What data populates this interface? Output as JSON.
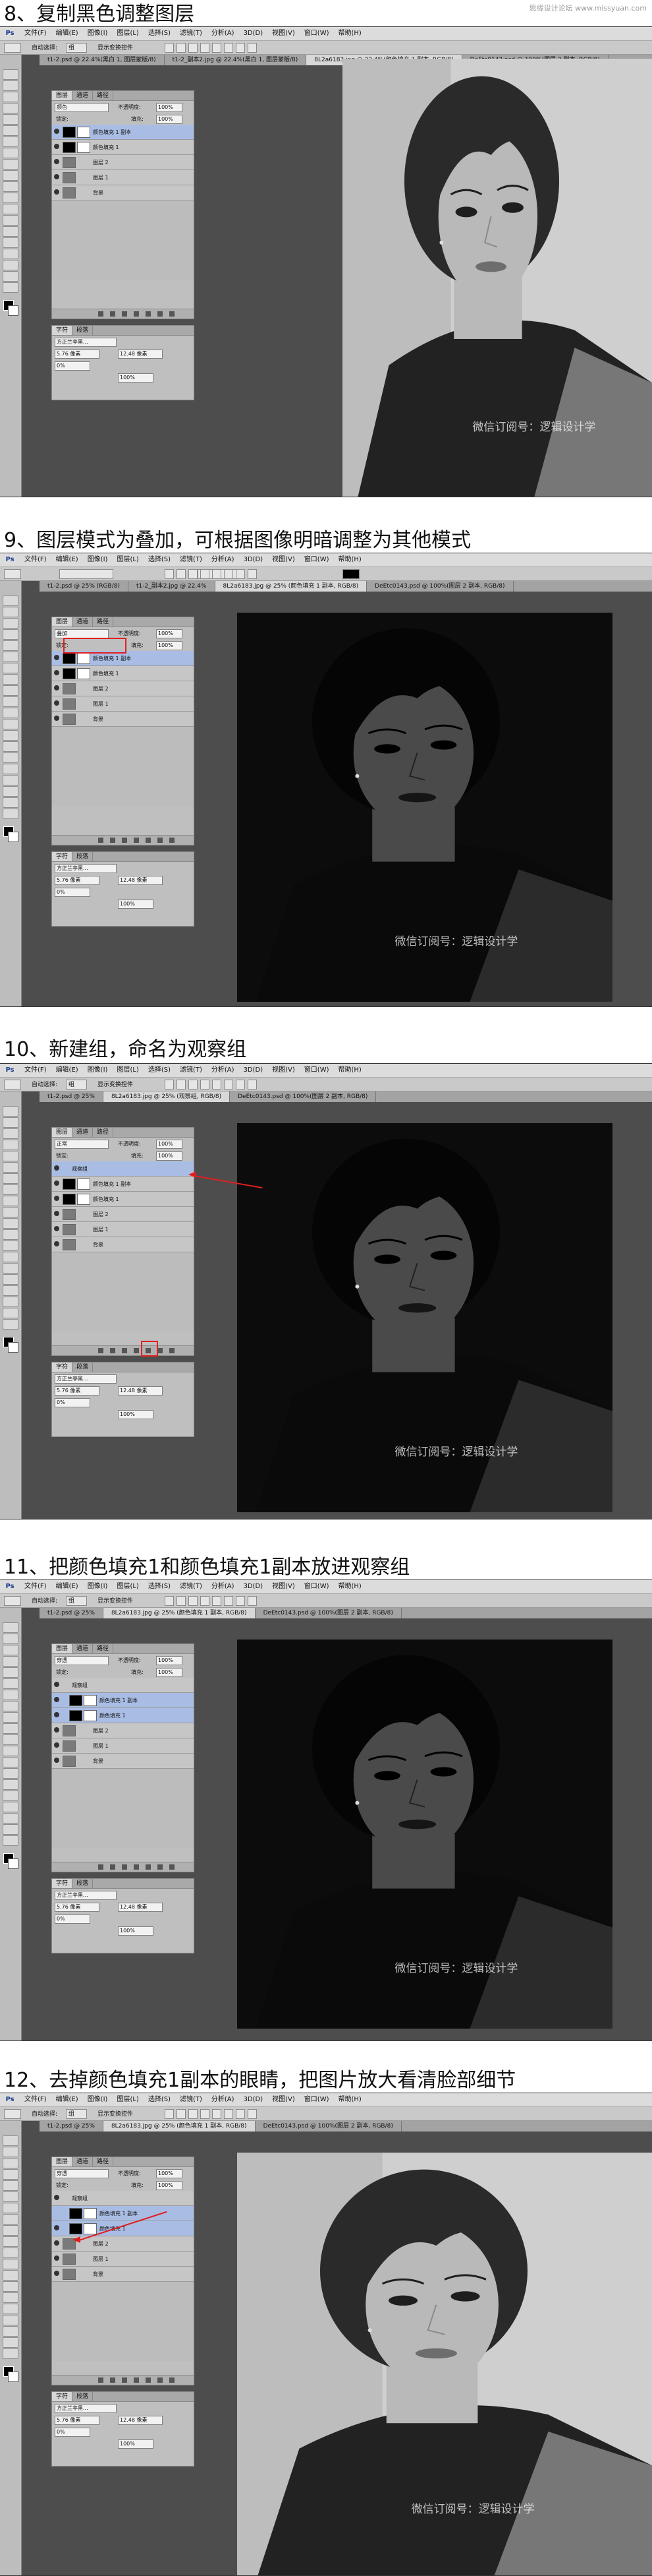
{
  "watermark_site": "思缘设计论坛 www.missyuan.com",
  "canvas_watermark": "微信订阅号：逻辑设计学",
  "menu": {
    "logo": "Ps",
    "items": [
      "文件(F)",
      "编辑(E)",
      "图像(I)",
      "图层(L)",
      "选择(S)",
      "滤镜(T)",
      "分析(A)",
      "3D(D)",
      "视图(V)",
      "窗口(W)",
      "帮助(H)"
    ]
  },
  "options_bar": {
    "auto_select": "自动选择:",
    "group_value": "组",
    "show_transform": "显示变换控件"
  },
  "layers_panel": {
    "tabs": [
      "图层",
      "通道",
      "路径"
    ],
    "blend_mode": "颜色",
    "opacity_label": "不透明度:",
    "opacity_value": "100%",
    "lock_label": "锁定:",
    "fill_label": "填充:",
    "fill_value": "100%"
  },
  "char_panel": {
    "tabs": [
      "字符",
      "段落"
    ],
    "font": "方正兰亭黑...",
    "size": "5.76 像素",
    "leading": "12.48 像素",
    "tracking": "0%",
    "scale": "100%"
  },
  "steps": [
    {
      "title": "8、复制黑色调整图层",
      "blend_mode": "颜色",
      "tabs": [
        "t1-2.psd @ 22.4%(黑白 1, 图层蒙版/8)",
        "t1-2_副本2.jpg @ 22.4%(黑白 1, 图层蒙版/8)",
        "8L2a6183.jpg @ 22.4%(颜色填充 1 副本, RGB/8)",
        "DeEtc0143.psd @ 100%(图层 2 副本, RGB/8)"
      ],
      "layers": [
        "颜色填充 1 副本",
        "颜色填充 1",
        "图层 2",
        "图层 1",
        "背景"
      ]
    },
    {
      "title": "9、图层模式为叠加，可根据图像明暗调整为其他模式",
      "blend_mode": "叠加",
      "tabs": [
        "t1-2.psd @ 25% (RGB/8)",
        "t1-2_副本2.jpg @ 22.4%",
        "8L2a6183.jpg @ 25% (颜色填充 1 副本, RGB/8)",
        "DeEtc0143.psd @ 100%(图层 2 副本, RGB/8)"
      ],
      "layers": [
        "颜色填充 1 副本",
        "颜色填充 1",
        "图层 2",
        "图层 1",
        "背景"
      ]
    },
    {
      "title": "10、新建组，命名为观察组",
      "blend_mode": "正常",
      "tabs": [
        "t1-2.psd @ 25%",
        "8L2a6183.jpg @ 25% (观察组, RGB/8)",
        "DeEtc0143.psd @ 100%(图层 2 副本, RGB/8)"
      ],
      "group_name": "观察组",
      "layers": [
        "颜色填充 1 副本",
        "颜色填充 1",
        "图层 2",
        "图层 1",
        "背景"
      ]
    },
    {
      "title": "11、把颜色填充1和颜色填充1副本放进观察组",
      "blend_mode": "穿透",
      "tabs": [
        "t1-2.psd @ 25%",
        "8L2a6183.jpg @ 25% (颜色填充 1 副本, RGB/8)",
        "DeEtc0143.psd @ 100%(图层 2 副本, RGB/8)"
      ],
      "group_name": "观察组",
      "layers": [
        "颜色填充 1 副本",
        "颜色填充 1",
        "图层 2",
        "图层 1",
        "背景"
      ]
    },
    {
      "title": "12、去掉颜色填充1副本的眼睛，把图片放大看清脸部细节",
      "blend_mode": "穿透",
      "tabs": [
        "t1-2.psd @ 25%",
        "8L2a6183.jpg @ 25% (颜色填充 1 副本, RGB/8)",
        "DeEtc0143.psd @ 100%(图层 2 副本, RGB/8)"
      ],
      "group_name": "观察组",
      "layers": [
        "颜色填充 1 副本",
        "颜色填充 1",
        "图层 2",
        "图层 1",
        "背景"
      ]
    }
  ]
}
